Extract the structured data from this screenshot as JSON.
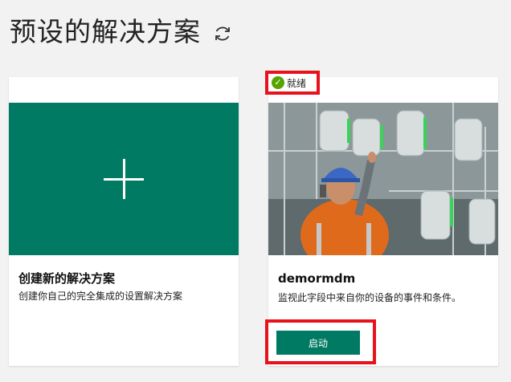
{
  "header": {
    "title": "预设的解决方案",
    "refresh_icon": "refresh-icon"
  },
  "cards": {
    "create": {
      "title": "创建新的解决方案",
      "description": "创建你自己的完全集成的设置解决方案",
      "icon": "plus-icon",
      "tile_color": "#007a63"
    },
    "solution": {
      "status": "就绪",
      "status_icon": "check-icon",
      "title": "demormdm",
      "description": "监视此字段中来自你的设备的事件和条件。",
      "launch_label": "启动",
      "accent_color": "#007a63",
      "highlight_color": "#e8121d"
    }
  }
}
